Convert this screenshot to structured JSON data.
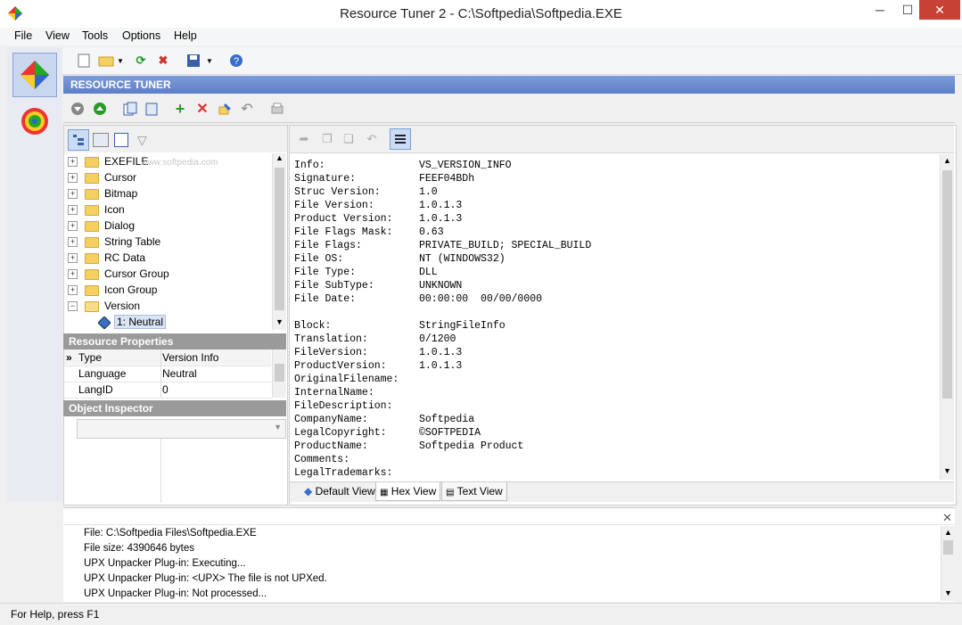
{
  "window": {
    "title": "Resource Tuner 2 - C:\\Softpedia\\Softpedia.EXE",
    "minimize": "─",
    "maximize": "☐",
    "close": "✕"
  },
  "menu": [
    "File",
    "View",
    "Tools",
    "Options",
    "Help"
  ],
  "panel_title": "RESOURCE TUNER",
  "tree": {
    "items": [
      {
        "label": "EXEFILE"
      },
      {
        "label": "Cursor"
      },
      {
        "label": "Bitmap"
      },
      {
        "label": "Icon"
      },
      {
        "label": "Dialog"
      },
      {
        "label": "String Table"
      },
      {
        "label": "RC Data"
      },
      {
        "label": "Cursor Group"
      },
      {
        "label": "Icon Group"
      },
      {
        "label": "Version"
      }
    ],
    "selected_child": "1: Neutral",
    "watermark": "www.softpedia.com"
  },
  "resource_properties": {
    "title": "Resource Properties",
    "rows": [
      {
        "key": "Type",
        "value": "Version Info"
      },
      {
        "key": "Language",
        "value": "Neutral"
      },
      {
        "key": "LangID",
        "value": "0"
      }
    ]
  },
  "object_inspector": {
    "title": "Object Inspector"
  },
  "version_info": [
    {
      "k": "Info:",
      "v": "VS_VERSION_INFO"
    },
    {
      "k": "Signature:",
      "v": "FEEF04BDh"
    },
    {
      "k": "Struc Version:",
      "v": "1.0"
    },
    {
      "k": "File Version:",
      "v": "1.0.1.3"
    },
    {
      "k": "Product Version:",
      "v": "1.0.1.3"
    },
    {
      "k": "File Flags Mask:",
      "v": "0.63"
    },
    {
      "k": "File Flags:",
      "v": "PRIVATE_BUILD; SPECIAL_BUILD"
    },
    {
      "k": "File OS:",
      "v": "NT (WINDOWS32)"
    },
    {
      "k": "File Type:",
      "v": "DLL"
    },
    {
      "k": "File SubType:",
      "v": "UNKNOWN"
    },
    {
      "k": "File Date:",
      "v": "00:00:00  00/00/0000"
    },
    {
      "k": "",
      "v": ""
    },
    {
      "k": "Block:",
      "v": "StringFileInfo"
    },
    {
      "k": "Translation:",
      "v": "0/1200"
    },
    {
      "k": "FileVersion:",
      "v": "1.0.1.3"
    },
    {
      "k": "ProductVersion:",
      "v": "1.0.1.3"
    },
    {
      "k": "OriginalFilename:",
      "v": ""
    },
    {
      "k": "InternalName:",
      "v": ""
    },
    {
      "k": "FileDescription:",
      "v": ""
    },
    {
      "k": "CompanyName:",
      "v": "Softpedia"
    },
    {
      "k": "LegalCopyright:",
      "v": "©SOFTPEDIA"
    },
    {
      "k": "ProductName:",
      "v": "Softpedia Product"
    },
    {
      "k": "Comments:",
      "v": ""
    },
    {
      "k": "LegalTrademarks:",
      "v": ""
    }
  ],
  "view_tabs": [
    "Default View",
    "Hex View",
    "Text View"
  ],
  "log": [
    "File: C:\\Softpedia Files\\Softpedia.EXE",
    "File size: 4390646 bytes",
    "UPX Unpacker Plug-in: Executing...",
    "UPX Unpacker Plug-in: <UPX> The file is not UPXed.",
    "UPX Unpacker Plug-in: Not processed..."
  ],
  "status": "For Help, press F1",
  "colors": {
    "accent": "#5d7fc8",
    "close": "#c74234"
  }
}
